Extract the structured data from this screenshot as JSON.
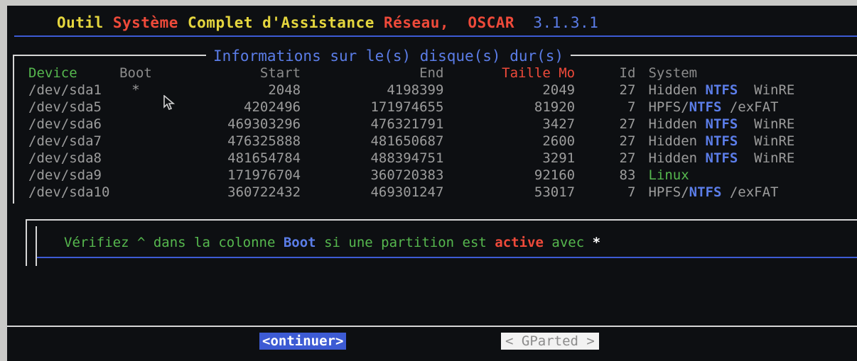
{
  "header": {
    "title_part1": "Outil ",
    "title_part2": "Système ",
    "title_part3": "Complet d'Assistance ",
    "title_part4": "Réseau,  ",
    "title_part5": "OSCAR  ",
    "version": "3.1.3.1"
  },
  "panel": {
    "title": "Informations sur le(s) disque(s) dur(s)"
  },
  "table": {
    "headers": {
      "device": "Device",
      "boot": "Boot",
      "start": "Start",
      "end": "End",
      "size": "Taille Mo",
      "id": "Id",
      "system": "System"
    },
    "rows": [
      {
        "device": "/dev/sda1",
        "boot": "*",
        "start": "2048",
        "end": "4198399",
        "size": "2049",
        "id": "27",
        "sys_a": "Hidden ",
        "sys_b": "NTFS",
        "sys_c": "  WinRE"
      },
      {
        "device": "/dev/sda5",
        "boot": "",
        "start": "4202496",
        "end": "171974655",
        "size": "81920",
        "id": "7",
        "sys_a": "HPFS/",
        "sys_b": "NTFS",
        "sys_c": " /exFAT"
      },
      {
        "device": "/dev/sda6",
        "boot": "",
        "start": "469303296",
        "end": "476321791",
        "size": "3427",
        "id": "27",
        "sys_a": "Hidden ",
        "sys_b": "NTFS",
        "sys_c": "  WinRE"
      },
      {
        "device": "/dev/sda7",
        "boot": "",
        "start": "476325888",
        "end": "481650687",
        "size": "2600",
        "id": "27",
        "sys_a": "Hidden ",
        "sys_b": "NTFS",
        "sys_c": "  WinRE"
      },
      {
        "device": "/dev/sda8",
        "boot": "",
        "start": "481654784",
        "end": "488394751",
        "size": "3291",
        "id": "27",
        "sys_a": "Hidden ",
        "sys_b": "NTFS",
        "sys_c": "  WinRE"
      },
      {
        "device": "/dev/sda9",
        "boot": "",
        "start": "171976704",
        "end": "360720383",
        "size": "92160",
        "id": "83",
        "sys_linux": "Linux"
      },
      {
        "device": "/dev/sda10",
        "boot": "",
        "start": "360722432",
        "end": "469301247",
        "size": "53017",
        "id": "7",
        "sys_a": "HPFS/",
        "sys_b": "NTFS",
        "sys_c": " /exFAT"
      }
    ]
  },
  "message": {
    "part1": "Vérifiez ^ dans la colonne ",
    "boot": "Boot",
    "part2": " si une partition est ",
    "active": "active",
    "part3": " avec ",
    "star": "*"
  },
  "buttons": {
    "continue_open": "<",
    "continue_label": "ontinuer",
    "continue_close": ">",
    "gparted_label": "< GParted >"
  },
  "colors": {
    "accent_blue": "#3d5bd4",
    "green": "#56b84e",
    "red": "#ee4a3a",
    "yellow": "#e5d63e"
  },
  "icons": {
    "cursor": "mouse-pointer-icon"
  }
}
